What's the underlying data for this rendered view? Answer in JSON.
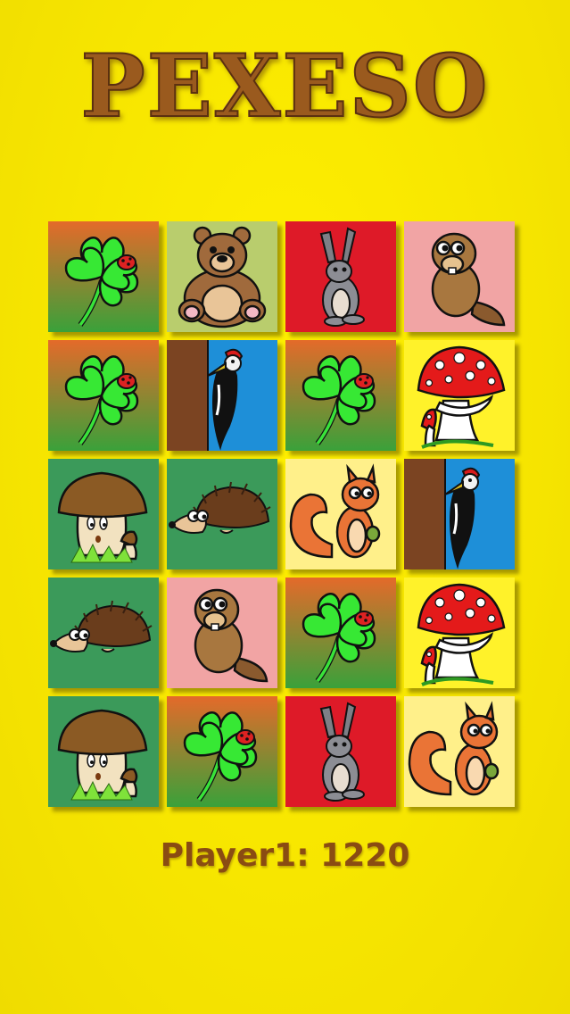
{
  "title": "PEXESO",
  "score": {
    "player_label": "Player1:",
    "points": "1220"
  },
  "board": {
    "rows": 5,
    "cols": 4,
    "cards": [
      {
        "name": "card-clover",
        "kind": "clover"
      },
      {
        "name": "card-bear",
        "kind": "bear"
      },
      {
        "name": "card-rabbit",
        "kind": "rabbit"
      },
      {
        "name": "card-beaver",
        "kind": "beaver"
      },
      {
        "name": "card-clover",
        "kind": "clover"
      },
      {
        "name": "card-woodpecker",
        "kind": "woodpecker"
      },
      {
        "name": "card-clover",
        "kind": "clover"
      },
      {
        "name": "card-fly-agaric",
        "kind": "amanita"
      },
      {
        "name": "card-porcini",
        "kind": "porcini"
      },
      {
        "name": "card-hedgehog",
        "kind": "hedgehog"
      },
      {
        "name": "card-squirrel",
        "kind": "squirrel"
      },
      {
        "name": "card-woodpecker",
        "kind": "woodpecker"
      },
      {
        "name": "card-hedgehog",
        "kind": "hedgehog"
      },
      {
        "name": "card-beaver",
        "kind": "beaver"
      },
      {
        "name": "card-clover",
        "kind": "clover"
      },
      {
        "name": "card-fly-agaric",
        "kind": "amanita"
      },
      {
        "name": "card-porcini",
        "kind": "porcini"
      },
      {
        "name": "card-clover",
        "kind": "clover"
      },
      {
        "name": "card-rabbit",
        "kind": "rabbit"
      },
      {
        "name": "card-squirrel",
        "kind": "squirrel"
      }
    ]
  },
  "colors": {
    "background": "#f7e600",
    "title": "#9a5a1e",
    "score": "#8a4c12"
  }
}
